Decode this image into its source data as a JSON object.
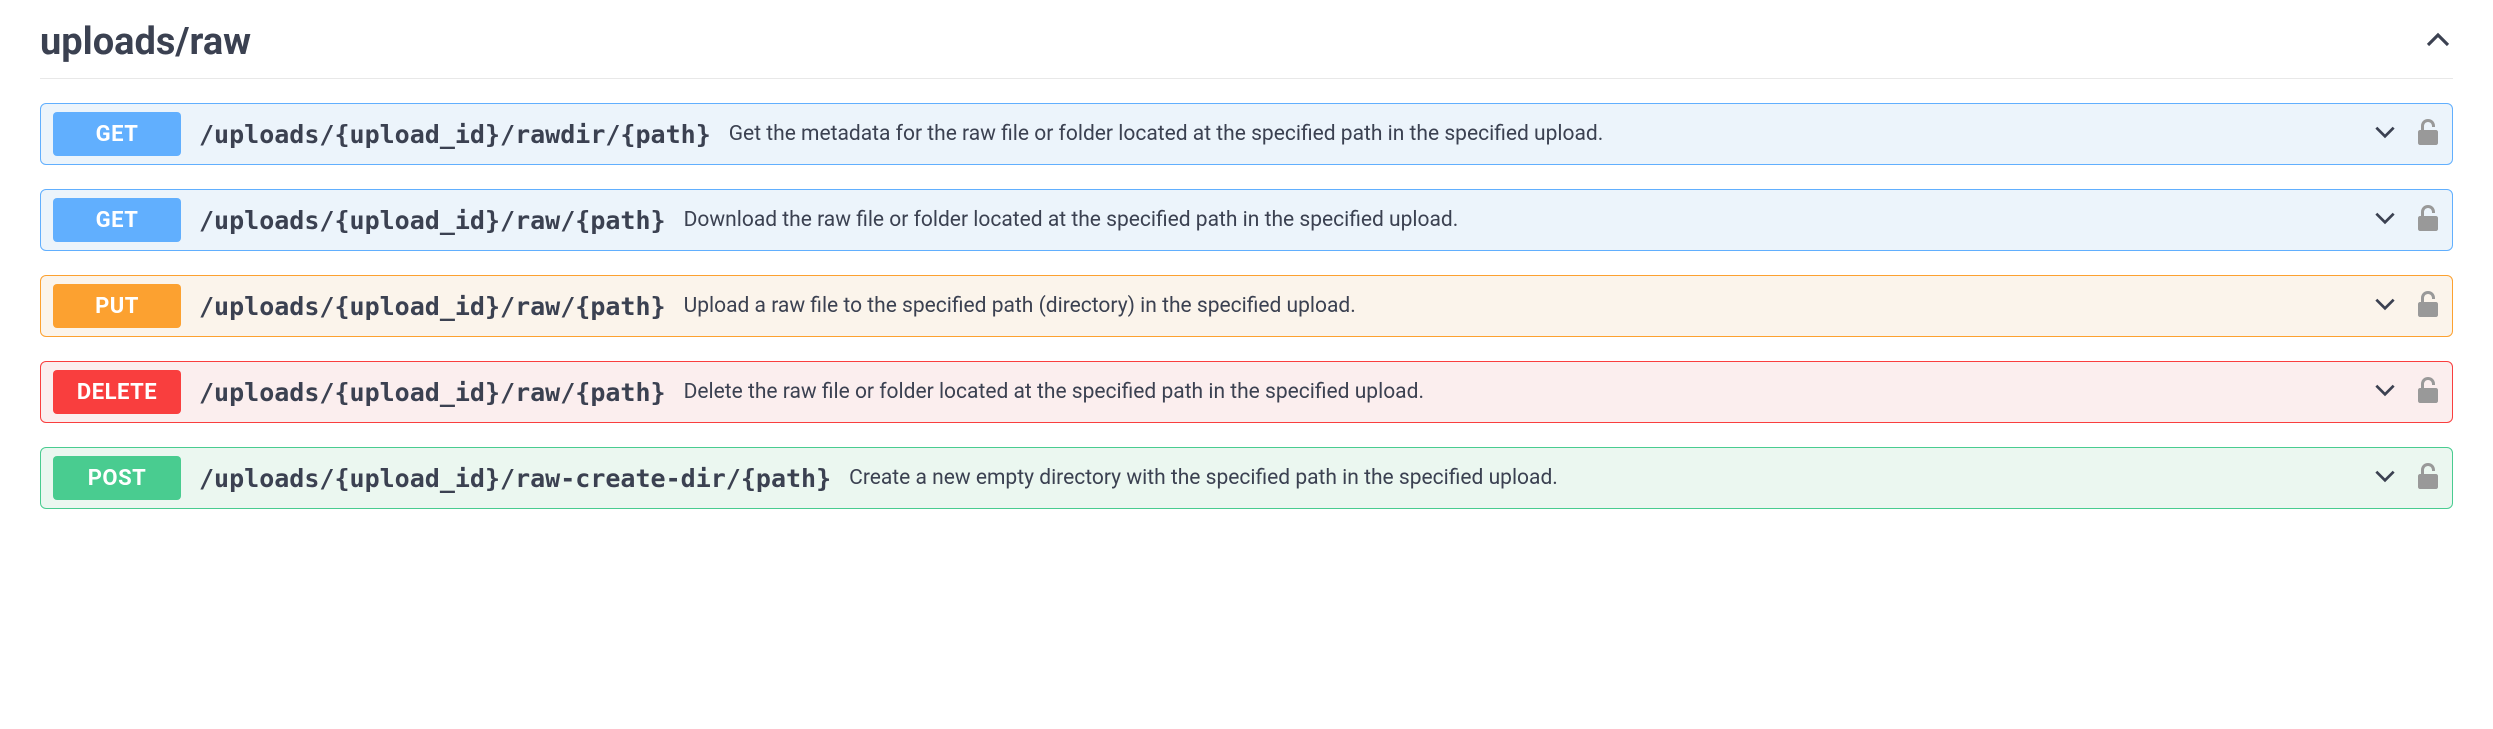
{
  "section": {
    "title": "uploads/raw"
  },
  "operations": [
    {
      "method": "GET",
      "method_class": "get",
      "path": "/uploads/{upload_id}/rawdir/{path}",
      "description": "Get the metadata for the raw file or folder located at the specified path in the specified upload."
    },
    {
      "method": "GET",
      "method_class": "get",
      "path": "/uploads/{upload_id}/raw/{path}",
      "description": "Download the raw file or folder located at the specified path in the specified upload."
    },
    {
      "method": "PUT",
      "method_class": "put",
      "path": "/uploads/{upload_id}/raw/{path}",
      "description": "Upload a raw file to the specified path (directory) in the specified upload."
    },
    {
      "method": "DELETE",
      "method_class": "delete",
      "path": "/uploads/{upload_id}/raw/{path}",
      "description": "Delete the raw file or folder located at the specified path in the specified upload."
    },
    {
      "method": "POST",
      "method_class": "post",
      "path": "/uploads/{upload_id}/raw-create-dir/{path}",
      "description": "Create a new empty directory with the specified path in the specified upload."
    }
  ]
}
